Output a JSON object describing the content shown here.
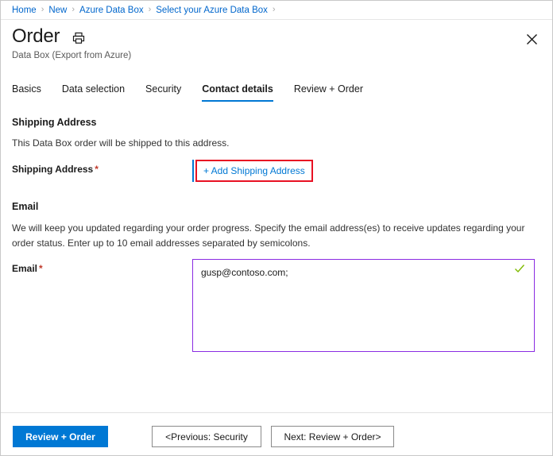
{
  "breadcrumb": {
    "items": [
      {
        "label": "Home"
      },
      {
        "label": "New"
      },
      {
        "label": "Azure Data Box"
      },
      {
        "label": "Select your Azure Data Box"
      }
    ],
    "separator": "›"
  },
  "header": {
    "title": "Order",
    "subtitle": "Data Box (Export from Azure)",
    "print_icon": "printer-icon",
    "close_icon": "close-icon"
  },
  "tabs": [
    {
      "label": "Basics",
      "active": false
    },
    {
      "label": "Data selection",
      "active": false
    },
    {
      "label": "Security",
      "active": false
    },
    {
      "label": "Contact details",
      "active": true
    },
    {
      "label": "Review + Order",
      "active": false
    }
  ],
  "shipping": {
    "heading": "Shipping Address",
    "description": "This Data Box order will be shipped to this address.",
    "field_label": "Shipping Address",
    "required_marker": "*",
    "add_link": "+ Add Shipping Address",
    "highlight_color": "#e81123",
    "accent_color": "#0078d4"
  },
  "email": {
    "heading": "Email",
    "description": "We will keep you updated regarding your order progress. Specify the email address(es) to receive updates regarding your order status. Enter up to 10 email addresses separated by semicolons.",
    "field_label": "Email",
    "required_marker": "*",
    "value": "gusp@contoso.com;",
    "placeholder": "",
    "validation_icon": "check-icon",
    "validation_color": "#7fba00",
    "border_color": "#8a2be2"
  },
  "footer": {
    "primary_button": "Review + Order",
    "previous_button": "<Previous: Security",
    "next_button": "Next: Review + Order>"
  }
}
